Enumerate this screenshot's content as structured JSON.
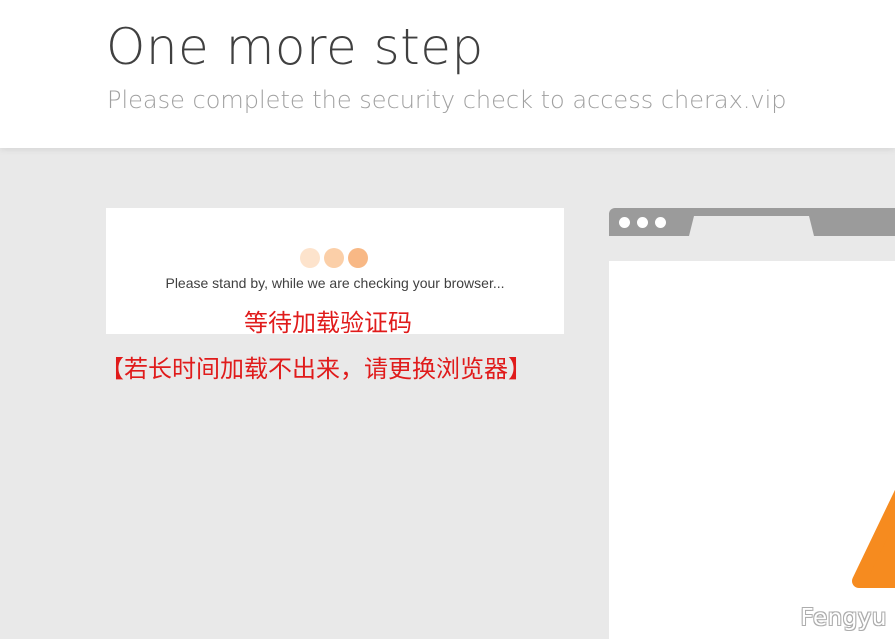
{
  "header": {
    "title": "One more step",
    "subtitle": "Please complete the security check to access cherax.vip"
  },
  "check": {
    "standby_text": "Please stand by, while we are checking your browser..."
  },
  "annotations": {
    "line1": "等待加载验证码",
    "line2": "【若长时间加载不出来，请更换浏览器】"
  },
  "illustration": {
    "icon": "warning-icon",
    "accent_color": "#f68b1f"
  },
  "watermark": "Fengyu",
  "colors": {
    "background": "#e9e9e9",
    "annotation": "#e01b1b",
    "loader_dots": [
      "#fde3cc",
      "#fbcfa8",
      "#f8b885"
    ],
    "browser_frame": "#9b9b9b"
  }
}
